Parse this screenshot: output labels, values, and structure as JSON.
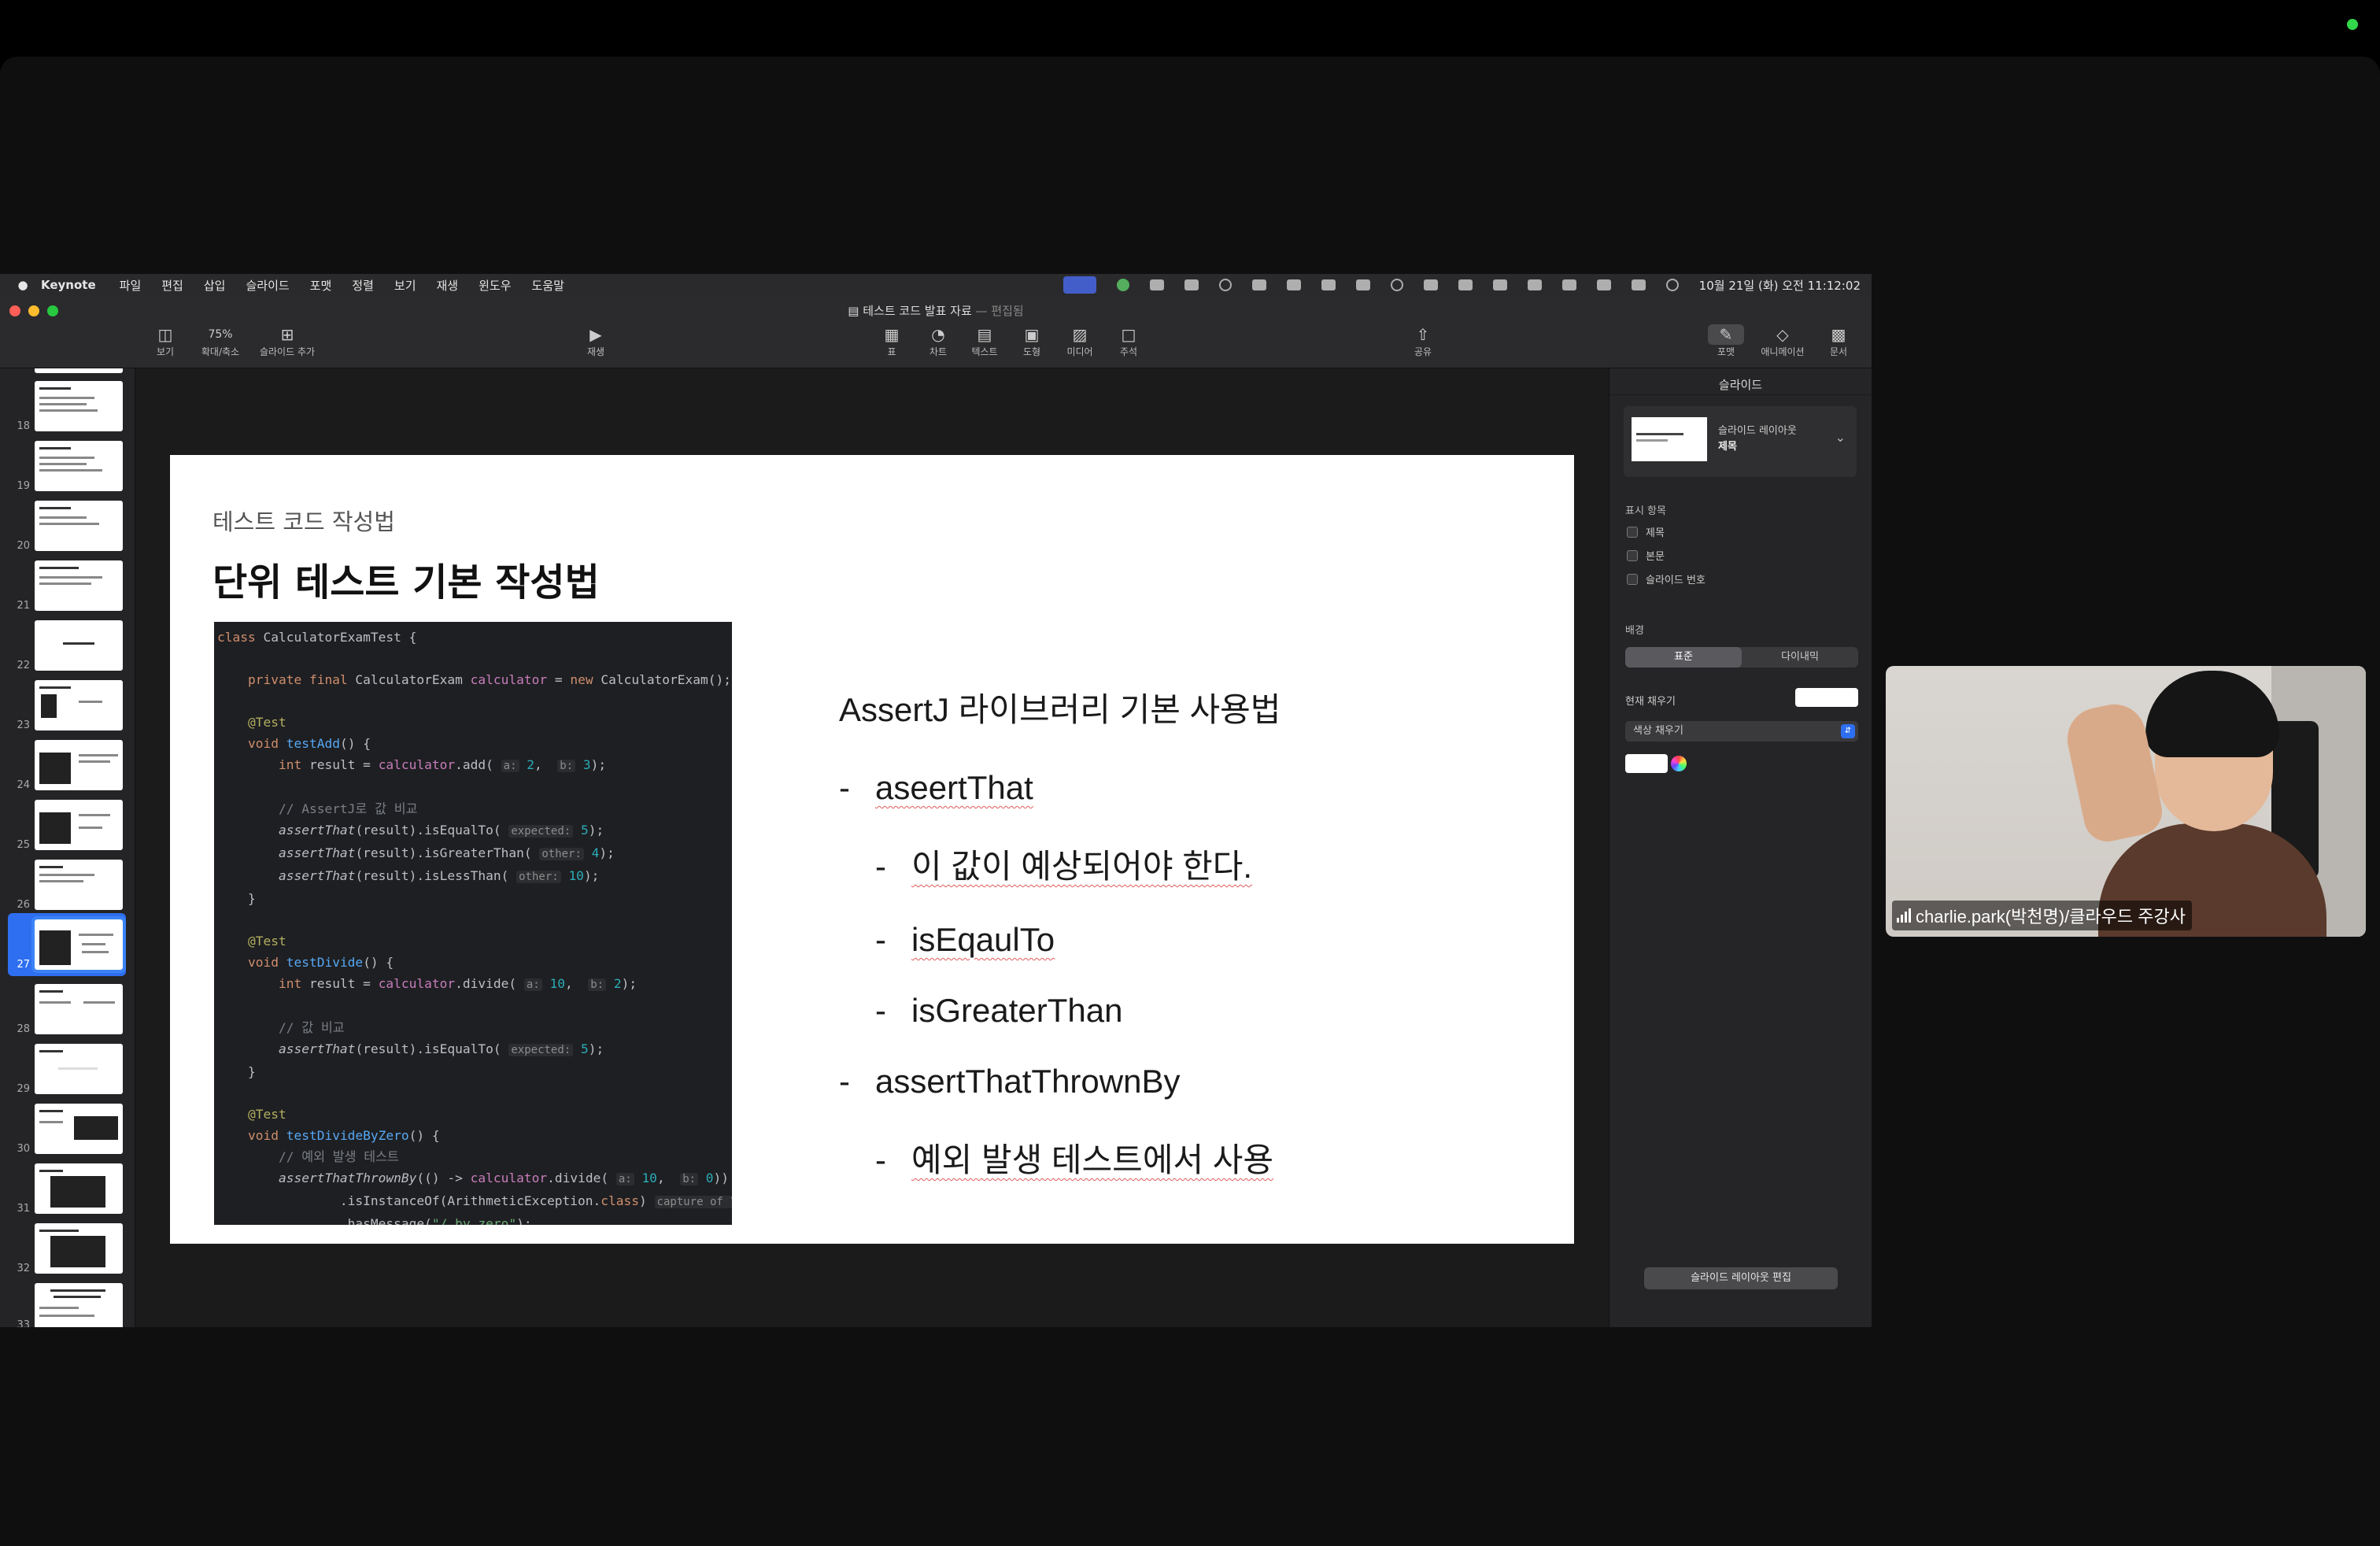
{
  "meeting": {
    "participant_name": "charlie.park(박천명)/클라우드 주강사"
  },
  "menubar": {
    "app_name": "Keynote",
    "items": [
      "파일",
      "편집",
      "삽입",
      "슬라이드",
      "포맷",
      "정렬",
      "보기",
      "재생",
      "윈도우",
      "도움말"
    ],
    "clock": "10월 21일 (화) 오전 11:12:02"
  },
  "window": {
    "title": "테스트 코드 발표 자료",
    "title_suffix": "— 편집됨"
  },
  "toolbar": {
    "view": "보기",
    "zoom_value": "75%",
    "zoom": "확대/축소",
    "add_slide": "슬라이드 추가",
    "play": "재생",
    "table": "표",
    "chart": "차트",
    "text": "텍스트",
    "shape": "도형",
    "media": "미디어",
    "comment": "주석",
    "share": "공유",
    "format": "포맷",
    "animate": "애니메이션",
    "document": "문서"
  },
  "navigator": {
    "slide_numbers": [
      "18",
      "19",
      "20",
      "21",
      "22",
      "23",
      "24",
      "25",
      "26",
      "27",
      "28",
      "29",
      "30",
      "31",
      "32",
      "33"
    ],
    "selected": "27"
  },
  "slide": {
    "subtitle": "테스트 코드 작성법",
    "title": "단위 테스트 기본 작성법",
    "right_heading": "AssertJ 라이브러리 기본 사용법",
    "bullets": [
      {
        "level": 1,
        "text": "aseertThat"
      },
      {
        "level": 2,
        "text": "이 값이 예상되어야 한다."
      },
      {
        "level": 2,
        "text": "isEqaulTo"
      },
      {
        "level": 2,
        "text": "isGreaterThan"
      },
      {
        "level": 1,
        "text": "assertThatThrownBy"
      },
      {
        "level": 2,
        "text": "예외 발생 테스트에서 사용"
      }
    ]
  },
  "inspector": {
    "tab": "슬라이드",
    "layout_label": "슬라이드 레이아웃",
    "layout_name": "제목",
    "show_label": "표시 항목",
    "cb_title": "제목",
    "cb_body": "본문",
    "cb_number": "슬라이드 번호",
    "bg_label": "배경",
    "seg_standard": "표준",
    "seg_dynamic": "다이내믹",
    "current_fill": "현재 채우기",
    "fill_type": "색상 채우기",
    "edit_layout": "슬라이드 레이아웃 편집"
  }
}
